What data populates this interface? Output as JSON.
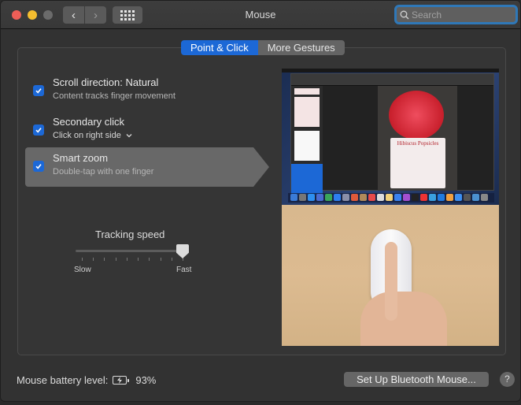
{
  "window": {
    "title": "Mouse",
    "search_placeholder": "Search",
    "nav": {
      "back": "‹",
      "forward": "›"
    }
  },
  "tabs": [
    {
      "label": "Point & Click",
      "active": true
    },
    {
      "label": "More Gestures",
      "active": false
    }
  ],
  "options": [
    {
      "title": "Scroll direction: Natural",
      "subtitle": "Content tracks finger movement",
      "checked": true,
      "selected": false
    },
    {
      "title": "Secondary click",
      "subtitle": "Click on right side",
      "subtitle_dropdown": true,
      "checked": true,
      "selected": false
    },
    {
      "title": "Smart zoom",
      "subtitle": "Double-tap with one finger",
      "checked": true,
      "selected": true
    }
  ],
  "tracking_speed": {
    "label": "Tracking speed",
    "min_label": "Slow",
    "max_label": "Fast",
    "value_fraction": 1.0,
    "tick_count": 10
  },
  "preview": {
    "description": "Pages document preview with Magic Mouse double-tap demonstration",
    "document_title": "Hibiscus Popsicles"
  },
  "footer": {
    "battery_label": "Mouse battery level:",
    "battery_icon": "battery-charging-icon",
    "battery_percent": "93%",
    "setup_button": "Set Up Bluetooth Mouse...",
    "help_button": "?"
  },
  "colors": {
    "accent": "#1c68d6",
    "close": "#ed5e57",
    "minimize": "#f4bd2f",
    "search_focus": "#2f78b8"
  }
}
